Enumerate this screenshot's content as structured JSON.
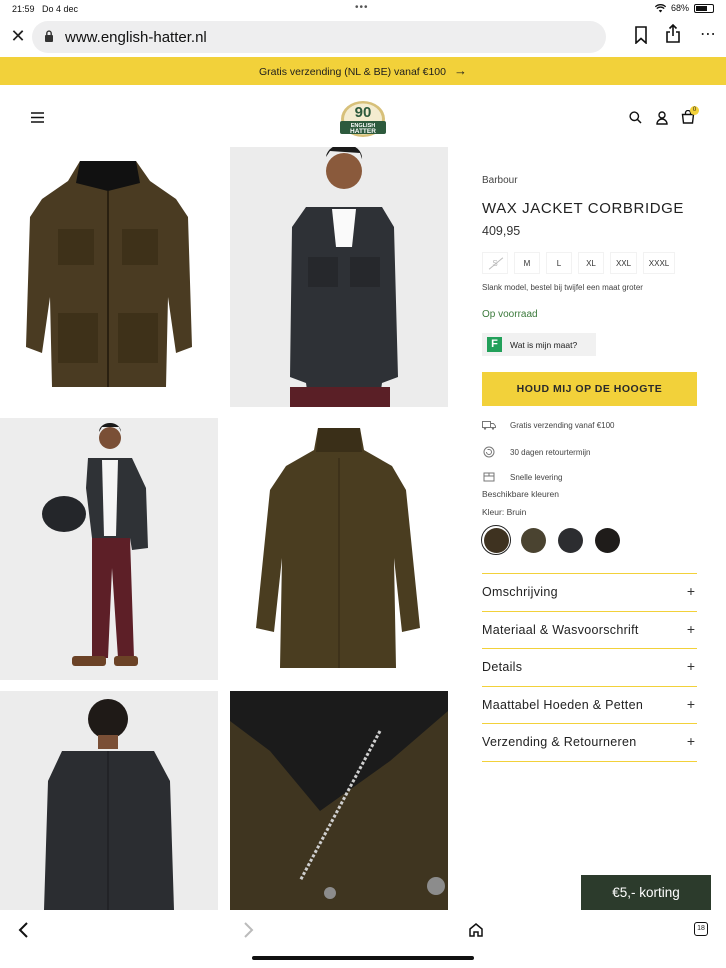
{
  "status": {
    "time": "21:59",
    "date": "Do 4 dec",
    "battery": "68%"
  },
  "browser": {
    "url": "www.english-hatter.nl",
    "tab_count": "18"
  },
  "promo": {
    "text": "Gratis verzending (NL & BE) vanaf €100"
  },
  "logo": {
    "number": "90",
    "line1": "ENGLISH",
    "line2": "HATTER"
  },
  "header": {
    "cart_count": "0"
  },
  "product": {
    "brand": "Barbour",
    "title": "WAX JACKET CORBRIDGE",
    "price": "409,95",
    "sizes": [
      {
        "label": "S",
        "available": false
      },
      {
        "label": "M",
        "available": true
      },
      {
        "label": "L",
        "available": true
      },
      {
        "label": "XL",
        "available": true
      },
      {
        "label": "XXL",
        "available": true
      },
      {
        "label": "XXXL",
        "available": true
      }
    ],
    "fit_note": "Slank model, bestel bij twijfel een maat groter",
    "stock": "Op voorraad",
    "fitfinder_label": "Wat is mijn maat?",
    "cta": "HOUD MIJ OP DE HOOGTE",
    "usps": [
      "Gratis verzending vanaf €100",
      "30 dagen retourtermijn",
      "Snelle levering"
    ],
    "colors_heading": "Beschikbare kleuren",
    "color_selected": "Kleur: Bruin",
    "swatches": [
      "#3e3220",
      "#4a4330",
      "#2c2d30",
      "#1f1c1a"
    ],
    "accordion": [
      "Omschrijving",
      "Materiaal & Wasvoorschrift",
      "Details",
      "Maattabel Hoeden & Petten",
      "Verzending & Retourneren"
    ]
  },
  "discount": {
    "label": "€5,- korting"
  },
  "colors": {
    "accent": "#f2d13a",
    "discount_bg": "#2c3b2c",
    "stock_green": "#3b7a3b"
  }
}
